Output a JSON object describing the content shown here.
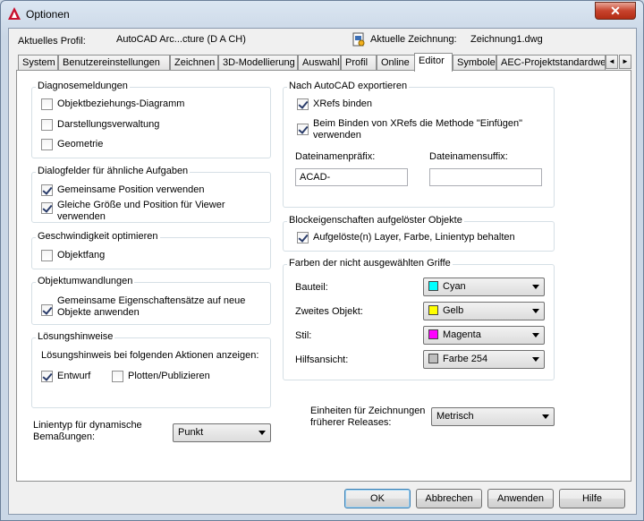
{
  "window": {
    "title": "Optionen",
    "close_glyph": "✕",
    "logo_color": "#c8102e"
  },
  "profile": {
    "label": "Aktuelles Profil:",
    "value": "AutoCAD Arc...cture (D A CH)",
    "drawing_label": "Aktuelle Zeichnung:",
    "drawing_value": "Zeichnung1.dwg",
    "drawing_icon": "drawing-file-icon"
  },
  "tabs": [
    "System",
    "Benutzereinstellungen",
    "Zeichnen",
    "3D-Modellierung",
    "Auswahl",
    "Profil",
    "Online",
    "Editor",
    "Symbole",
    "AEC-Projektstandardwerte"
  ],
  "active_tab": "Editor",
  "tab_scroll": {
    "left": "◄",
    "right": "►"
  },
  "diagnose": {
    "title": "Diagnosemeldungen",
    "items": [
      {
        "label": "Objektbeziehungs-Diagramm",
        "checked": false
      },
      {
        "label": "Darstellungsverwaltung",
        "checked": false
      },
      {
        "label": "Geometrie",
        "checked": false
      }
    ]
  },
  "dialogs": {
    "title": "Dialogfelder für ähnliche Aufgaben",
    "items": [
      {
        "label": "Gemeinsame Position verwenden",
        "checked": true
      },
      {
        "label": "Gleiche Größe und Position für Viewer verwenden",
        "checked": true
      }
    ]
  },
  "speed": {
    "title": "Geschwindigkeit optimieren",
    "items": [
      {
        "label": "Objektfang",
        "checked": false
      }
    ]
  },
  "convert": {
    "title": "Objektumwandlungen",
    "items": [
      {
        "label": "Gemeinsame Eigenschaftensätze auf neue Objekte anwenden",
        "checked": true
      }
    ]
  },
  "hints": {
    "title": "Lösungshinweise",
    "subtitle": "Lösungshinweis bei folgenden Aktionen anzeigen:",
    "items": [
      {
        "label": "Entwurf",
        "checked": true
      },
      {
        "label": "Plotten/Publizieren",
        "checked": false
      }
    ]
  },
  "linetype": {
    "label": "Linientyp für dynamische Bemaßungen:",
    "value": "Punkt"
  },
  "export": {
    "title": "Nach AutoCAD exportieren",
    "items": [
      {
        "label": "XRefs binden",
        "checked": true
      },
      {
        "label": "Beim Binden von XRefs die Methode \"Einfügen\" verwenden",
        "checked": true
      }
    ],
    "prefix_label": "Dateinamenpräfix:",
    "prefix_value": "ACAD-",
    "suffix_label": "Dateinamensuffix:",
    "suffix_value": ""
  },
  "block": {
    "title": "Blockeigenschaften aufgelöster Objekte",
    "items": [
      {
        "label": "Aufgelöste(n) Layer, Farbe, Linientyp behalten",
        "checked": true
      }
    ]
  },
  "colors": {
    "title": "Farben der nicht ausgewählten Griffe",
    "rows": [
      {
        "label": "Bauteil:",
        "value": "Cyan",
        "color": "#00ffff"
      },
      {
        "label": "Zweites Objekt:",
        "value": "Gelb",
        "color": "#ffff00"
      },
      {
        "label": "Stil:",
        "value": "Magenta",
        "color": "#ff00ff"
      },
      {
        "label": "Hilfsansicht:",
        "value": "Farbe 254",
        "color": "#bebebe"
      }
    ]
  },
  "units": {
    "label": "Einheiten für Zeichnungen früherer Releases:",
    "value": "Metrisch"
  },
  "buttons": {
    "ok": "OK",
    "cancel": "Abbrechen",
    "apply": "Anwenden",
    "help": "Hilfe"
  }
}
